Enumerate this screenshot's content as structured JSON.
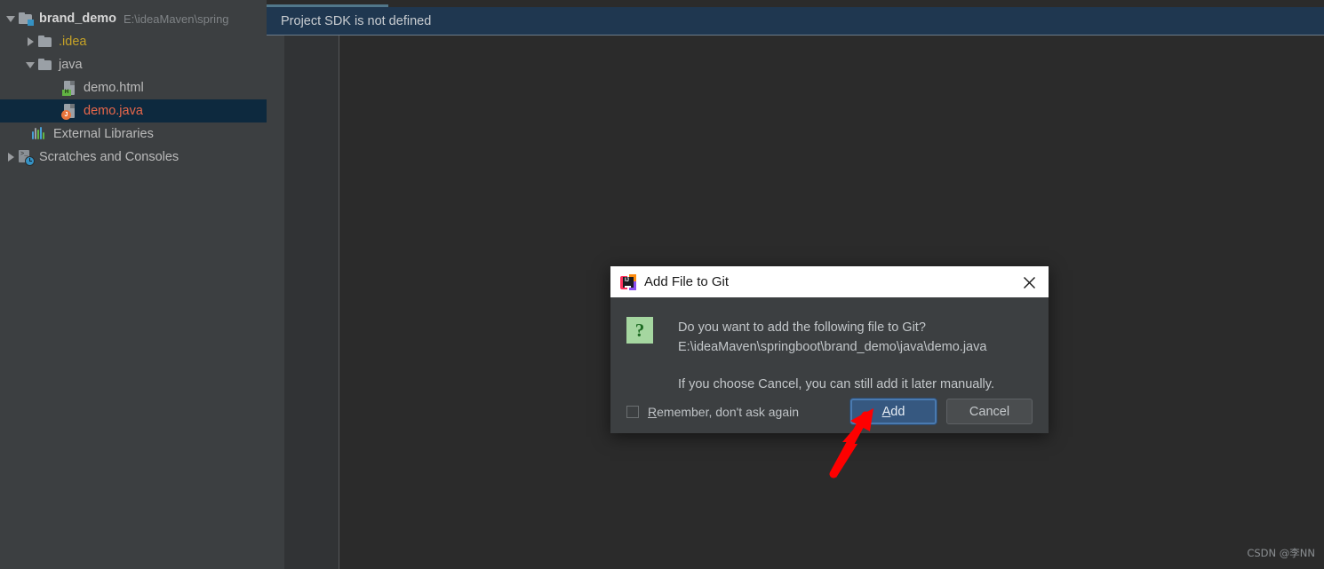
{
  "notification": {
    "text": "Project SDK is not defined"
  },
  "sidebar": {
    "items": [
      {
        "label": "brand_demo",
        "path": "E:\\ideaMaven\\spring",
        "icon": "module-folder-icon",
        "arrow": "down",
        "depth": 0,
        "style": "bold",
        "selected": false
      },
      {
        "label": ".idea",
        "path": "",
        "icon": "folder-icon",
        "arrow": "right",
        "depth": 1,
        "style": "yellow",
        "selected": false
      },
      {
        "label": "java",
        "path": "",
        "icon": "folder-icon",
        "arrow": "down",
        "depth": 1,
        "style": "plain",
        "selected": false
      },
      {
        "label": "demo.html",
        "path": "",
        "icon": "html-file-icon",
        "arrow": "none",
        "depth": 2,
        "style": "plain",
        "selected": false
      },
      {
        "label": "demo.java",
        "path": "",
        "icon": "java-file-icon",
        "arrow": "none",
        "depth": 2,
        "style": "red",
        "selected": true
      },
      {
        "label": "External Libraries",
        "path": "",
        "icon": "external-libraries-icon",
        "arrow": "none",
        "depth": 0.5,
        "style": "plain",
        "selected": false
      },
      {
        "label": "Scratches and Consoles",
        "path": "",
        "icon": "scratches-icon",
        "arrow": "right",
        "depth": 0,
        "style": "plain",
        "selected": false
      }
    ]
  },
  "dialog": {
    "title": "Add File to Git",
    "icon": "intellij-idea-icon",
    "close_icon": "close-icon",
    "question_icon": "question-mark-icon",
    "message_line1": "Do you want to add the following file to Git?",
    "message_line2": "E:\\ideaMaven\\springboot\\brand_demo\\java\\demo.java",
    "message_line3": "If you choose Cancel, you can still add it later manually.",
    "checkbox": {
      "label_mnemonic": "R",
      "label_rest": "emember, don't ask again",
      "checked": false
    },
    "buttons": {
      "add_mnemonic": "A",
      "add_rest": "dd",
      "cancel": "Cancel"
    }
  },
  "annotation": {
    "arrow_color": "#fe0000",
    "arrow_name": "red-pointer-arrow"
  },
  "watermark": {
    "text": "CSDN @李NN"
  },
  "colors": {
    "sidebar_bg": "#3c3f41",
    "editor_bg": "#2b2b2b",
    "selection_bg": "#0d293e",
    "notification_bg": "#1f3750",
    "accent_teal": "#51778a",
    "default_button": "#365880"
  }
}
